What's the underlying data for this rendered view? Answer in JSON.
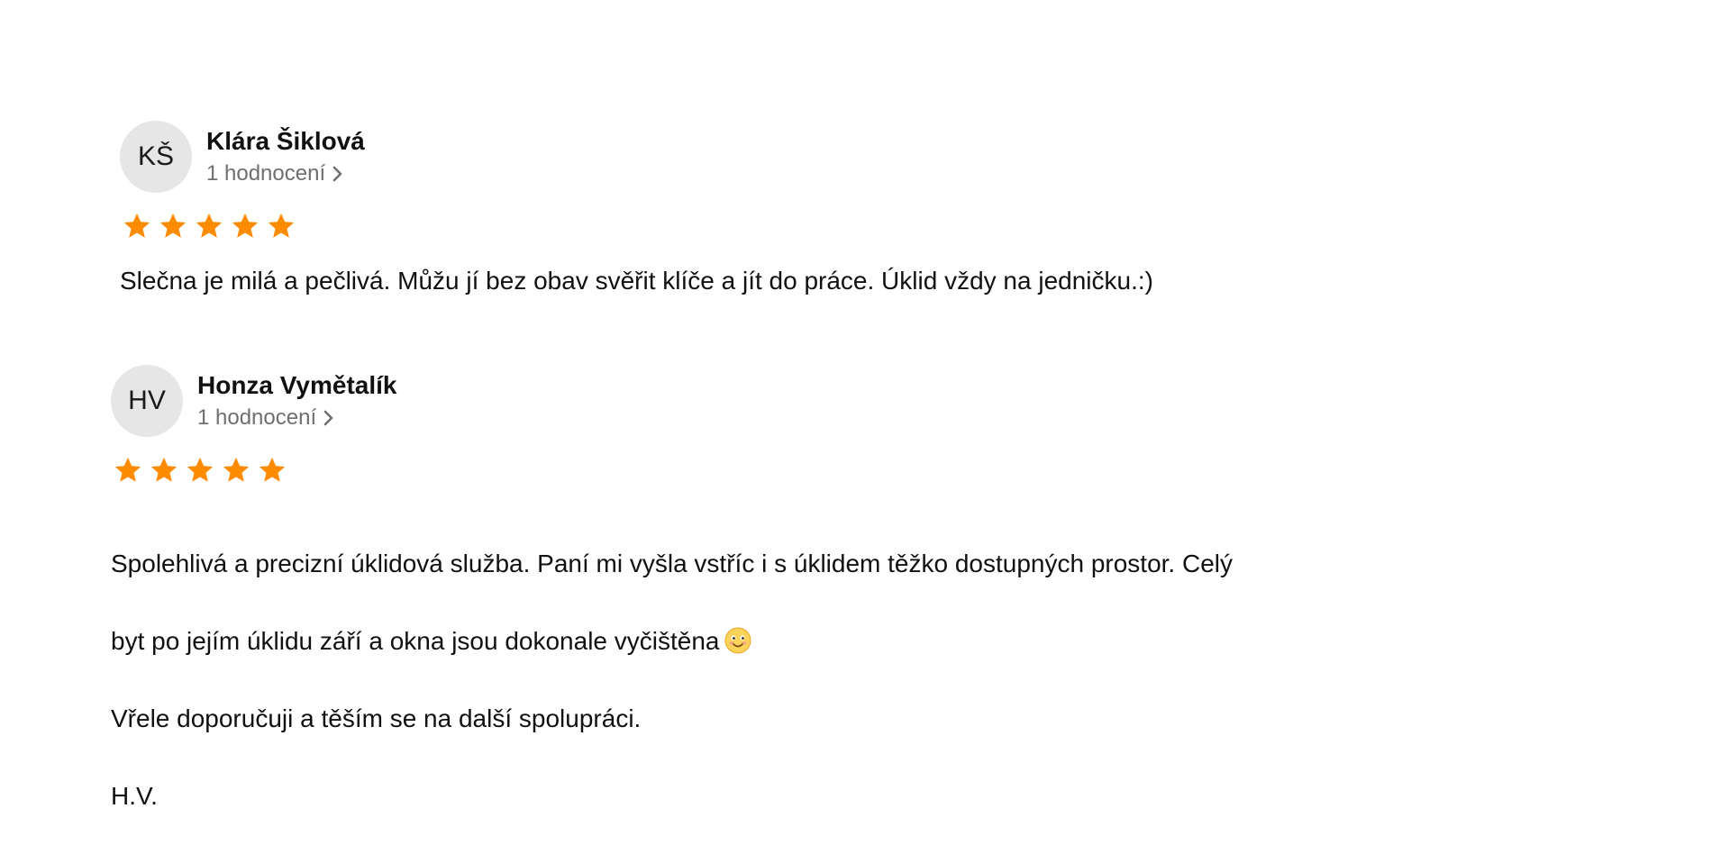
{
  "reviews": [
    {
      "initials": "KŠ",
      "name": "Klára Šiklová",
      "ratings_count": "1 hodnocení",
      "rating": 5,
      "text": "Slečna je milá a pečlivá. Můžu jí bez obav svěřit klíče a jít do práce. Úklid vždy na jedničku.:)"
    },
    {
      "initials": "HV",
      "name": "Honza Vymětalík",
      "ratings_count": "1 hodnocení",
      "rating": 5,
      "text_lines": [
        "Spolehlivá a precizní úklidová služba. Paní mi vyšla vstříc i s úklidem těžko dostupných prostor. Celý",
        "byt  po jejím úklidu září a okna jsou dokonale vyčištěna",
        "Vřele doporučuji a těším se na další spolupráci.",
        "H.V."
      ]
    }
  ],
  "colors": {
    "star": "#ff8c00",
    "avatar_bg": "#e6e6e6",
    "muted_text": "#6f6f6f"
  },
  "icons": {
    "star": "star-icon",
    "chevron": "chevron-right-icon",
    "emoji": "smiling-face-emoji-icon"
  }
}
